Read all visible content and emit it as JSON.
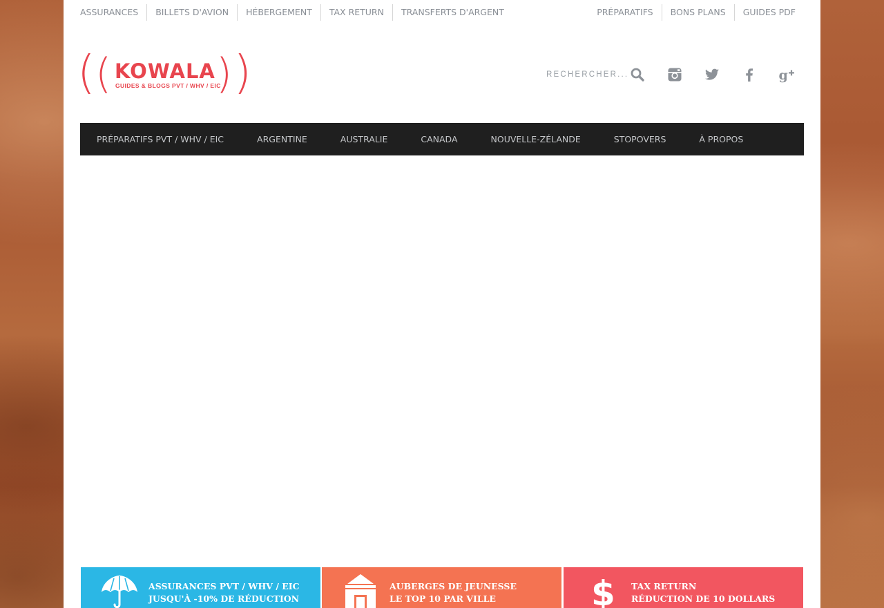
{
  "colors": {
    "brand_red": "#e8454e",
    "nav_bg": "#1f1f1f",
    "promo_blue": "#2bb7e5",
    "promo_orange": "#f47352",
    "promo_pink": "#f25660"
  },
  "top_links_left": [
    "ASSURANCES",
    "BILLETS D'AVION",
    "HÉBERGEMENT",
    "TAX RETURN",
    "TRANSFERTS D'ARGENT"
  ],
  "top_links_right": [
    "PRÉPARATIFS",
    "BONS PLANS",
    "GUIDES PDF"
  ],
  "logo": {
    "brand": "KOWALA",
    "tagline": "GUIDES & BLOGS PVT / WHV / EIC"
  },
  "search": {
    "placeholder": "RECHERCHER..."
  },
  "header_icons": [
    "search-icon",
    "instagram-icon",
    "twitter-icon",
    "facebook-icon",
    "google-plus-icon"
  ],
  "main_nav": [
    "PRÉPARATIFS PVT / WHV / EIC",
    "ARGENTINE",
    "AUSTRALIE",
    "CANADA",
    "NOUVELLE-ZÉLANDE",
    "STOPOVERS",
    "À PROPOS"
  ],
  "promos": [
    {
      "icon": "umbrella-icon",
      "title": "ASSURANCES PVT / WHV / EIC",
      "subtitle": "JUSQU'À -10% DE RÉDUCTION"
    },
    {
      "icon": "house-icon",
      "title": "AUBERGES DE JEUNESSE",
      "subtitle": "LE TOP 10 PAR VILLE"
    },
    {
      "icon": "dollar-icon",
      "title": "TAX RETURN",
      "subtitle": "RÉDUCTION DE 10 DOLLARS"
    }
  ]
}
